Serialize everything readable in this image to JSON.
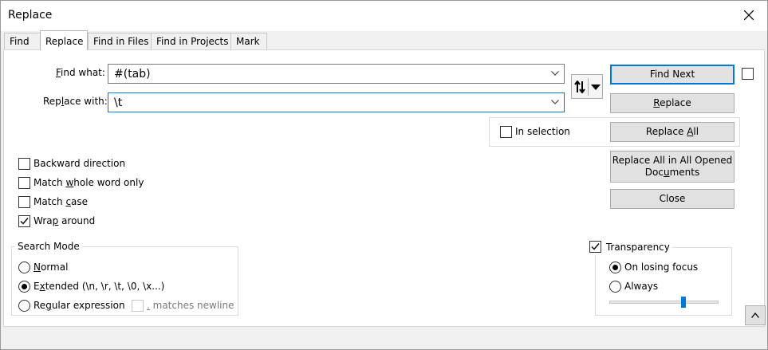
{
  "window": {
    "title": "Replace"
  },
  "tabs": [
    {
      "label": "Find",
      "active": false
    },
    {
      "label": "Replace",
      "active": true
    },
    {
      "label": "Find in Files",
      "active": false
    },
    {
      "label": "Find in Projects",
      "active": false
    },
    {
      "label": "Mark",
      "active": false
    }
  ],
  "find": {
    "label_pre": "",
    "label_u": "F",
    "label_post": "ind what:",
    "value": "#(tab)"
  },
  "replace": {
    "label_pre": "Rep",
    "label_u": "l",
    "label_post": "ace with:",
    "value": "\\t"
  },
  "in_selection": {
    "label": "In selection",
    "checked": false
  },
  "buttons": {
    "find_next": "Find Next",
    "replace_u": "R",
    "replace_rest": "eplace",
    "replace_all_pre": "Replace ",
    "replace_all_u": "A",
    "replace_all_post": "ll",
    "replace_all_docs_line1": "Replace All in All Opened",
    "replace_all_docs_line2_pre": "Doc",
    "replace_all_docs_line2_u": "u",
    "replace_all_docs_line2_post": "ments",
    "close": "Close"
  },
  "options": [
    {
      "pre": "Backward direction",
      "u": "",
      "post": "",
      "checked": false
    },
    {
      "pre": "Match ",
      "u": "w",
      "post": "hole word only",
      "checked": false
    },
    {
      "pre": "Match ",
      "u": "c",
      "post": "ase",
      "checked": false
    },
    {
      "pre": "Wra",
      "u": "p",
      "post": " around",
      "checked": true
    }
  ],
  "search_mode": {
    "title": "Search Mode",
    "options": [
      {
        "pre": "",
        "u": "N",
        "post": "ormal",
        "selected": false
      },
      {
        "pre": "E",
        "u": "x",
        "post": "tended (\\n, \\r, \\t, \\0, \\x...)",
        "selected": true
      },
      {
        "pre": "Re",
        "u": "g",
        "post": "ular expression",
        "selected": false
      }
    ],
    "matches_newline_u": ".",
    "matches_newline_post": " matches newline"
  },
  "transparency": {
    "label": "Transparency",
    "checked": true,
    "options": [
      {
        "label": "On losing focus",
        "selected": true
      },
      {
        "label": "Always",
        "selected": false
      }
    ],
    "level": 0.69
  },
  "colors": {
    "accent": "#0078d7"
  }
}
